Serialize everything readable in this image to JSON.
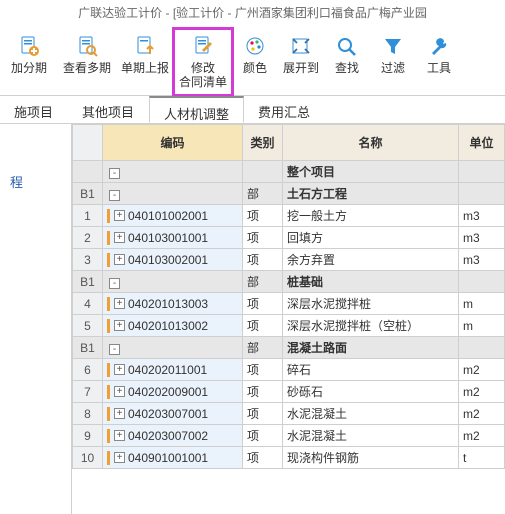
{
  "title": "广联达验工计价 - [验工计价 - 广州酒家集团利口福食品广梅产业园",
  "toolbar": [
    {
      "id": "add-period",
      "label": "加分期",
      "icon": "plus-doc",
      "highlight": false
    },
    {
      "id": "view-multi",
      "label": "查看多期",
      "icon": "search-doc",
      "highlight": false
    },
    {
      "id": "report-single",
      "label": "单期上报",
      "icon": "upload-doc",
      "highlight": false
    },
    {
      "id": "edit-contract",
      "label": "修改\n合同清单",
      "icon": "edit-doc",
      "highlight": true
    },
    {
      "id": "color",
      "label": "颜色",
      "icon": "palette",
      "highlight": false,
      "narrow": true
    },
    {
      "id": "expand",
      "label": "展开到",
      "icon": "expand",
      "highlight": false,
      "narrow": true
    },
    {
      "id": "find",
      "label": "查找",
      "icon": "find",
      "highlight": false,
      "narrow": true
    },
    {
      "id": "filter",
      "label": "过滤",
      "icon": "funnel",
      "highlight": false,
      "narrow": true
    },
    {
      "id": "tools",
      "label": "工具",
      "icon": "wrench",
      "highlight": false,
      "narrow": true
    }
  ],
  "tabs": [
    {
      "id": "meas",
      "label": "施项目",
      "active": false
    },
    {
      "id": "other",
      "label": "其他项目",
      "active": false
    },
    {
      "id": "adj",
      "label": "人材机调整",
      "active": true
    },
    {
      "id": "fee",
      "label": "费用汇总",
      "active": false
    }
  ],
  "side": {
    "item1": "程"
  },
  "columns": {
    "code": "编码",
    "cat": "类别",
    "name": "名称",
    "unit": "单位"
  },
  "rows": [
    {
      "type": "group",
      "rk": "",
      "toggle": "-",
      "code": "",
      "cat": "",
      "name": "整个项目",
      "unit": ""
    },
    {
      "type": "group",
      "rk": "B1",
      "toggle": "-",
      "code": "",
      "cat": "部",
      "name": "土石方工程",
      "unit": ""
    },
    {
      "type": "item",
      "rk": "1",
      "toggle": "+",
      "code": "040101002001",
      "cat": "项",
      "name": "挖一般土方",
      "unit": "m3"
    },
    {
      "type": "item",
      "rk": "2",
      "toggle": "+",
      "code": "040103001001",
      "cat": "项",
      "name": "回填方",
      "unit": "m3"
    },
    {
      "type": "item",
      "rk": "3",
      "toggle": "+",
      "code": "040103002001",
      "cat": "项",
      "name": "余方弃置",
      "unit": "m3"
    },
    {
      "type": "group",
      "rk": "B1",
      "toggle": "-",
      "code": "",
      "cat": "部",
      "name": "桩基础",
      "unit": ""
    },
    {
      "type": "item",
      "rk": "4",
      "toggle": "+",
      "code": "040201013003",
      "cat": "项",
      "name": "深层水泥搅拌桩",
      "unit": "m"
    },
    {
      "type": "item",
      "rk": "5",
      "toggle": "+",
      "code": "040201013002",
      "cat": "项",
      "name": "深层水泥搅拌桩（空桩）",
      "unit": "m"
    },
    {
      "type": "group",
      "rk": "B1",
      "toggle": "-",
      "code": "",
      "cat": "部",
      "name": "混凝土路面",
      "unit": ""
    },
    {
      "type": "item",
      "rk": "6",
      "toggle": "+",
      "code": "040202011001",
      "cat": "项",
      "name": "碎石",
      "unit": "m2"
    },
    {
      "type": "item",
      "rk": "7",
      "toggle": "+",
      "code": "040202009001",
      "cat": "项",
      "name": "砂砾石",
      "unit": "m2"
    },
    {
      "type": "item",
      "rk": "8",
      "toggle": "+",
      "code": "040203007001",
      "cat": "项",
      "name": "水泥混凝土",
      "unit": "m2"
    },
    {
      "type": "item",
      "rk": "9",
      "toggle": "+",
      "code": "040203007002",
      "cat": "项",
      "name": "水泥混凝土",
      "unit": "m2"
    },
    {
      "type": "item",
      "rk": "10",
      "toggle": "+",
      "code": "040901001001",
      "cat": "项",
      "name": "现浇构件钢筋",
      "unit": "t"
    }
  ]
}
